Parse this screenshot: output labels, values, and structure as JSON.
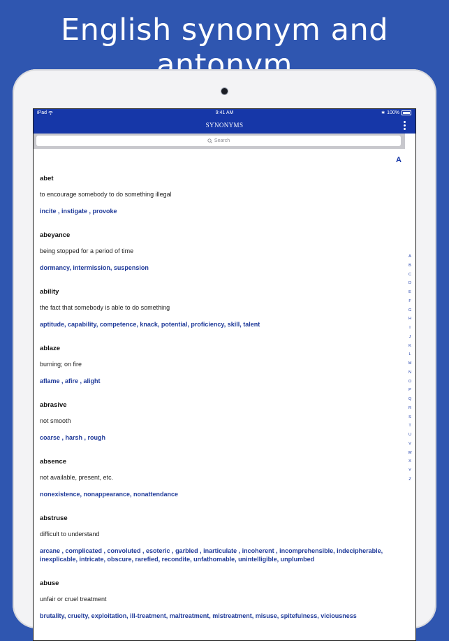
{
  "headline": "English synonym and antonym",
  "status": {
    "device": "iPad",
    "time": "9:41 AM",
    "battery": "100%"
  },
  "nav": {
    "title": "SYNONYMS"
  },
  "search": {
    "placeholder": "Search"
  },
  "section_letter": "A",
  "index_letters": [
    "A",
    "B",
    "C",
    "D",
    "E",
    "F",
    "G",
    "H",
    "I",
    "J",
    "K",
    "L",
    "M",
    "N",
    "O",
    "P",
    "Q",
    "R",
    "S",
    "T",
    "U",
    "V",
    "W",
    "X",
    "Y",
    "Z"
  ],
  "entries": [
    {
      "word": "abet",
      "definition": "to encourage somebody to do something illegal",
      "synonyms": "incite , instigate , provoke"
    },
    {
      "word": "abeyance",
      "definition": "being stopped for a period of time",
      "synonyms": "dormancy, intermission, suspension"
    },
    {
      "word": "ability",
      "definition": "the fact that somebody is able to do something",
      "synonyms": "aptitude, capability, competence, knack, potential, proficiency, skill, talent"
    },
    {
      "word": "ablaze",
      "definition": "burning; on fire",
      "synonyms": "aflame , afire , alight"
    },
    {
      "word": "abrasive",
      "definition": "not smooth",
      "synonyms": "coarse , harsh , rough"
    },
    {
      "word": "absence",
      "definition": "not available, present, etc.",
      "synonyms": "nonexistence, nonappearance, nonattendance"
    },
    {
      "word": "abstruse",
      "definition": "difficult to understand",
      "synonyms": "arcane , complicated , convoluted , esoteric , garbled , inarticulate , incoherent , incomprehensible, indecipherable, inexplicable, intricate, obscure, rarefied, recondite, unfathomable, unintelligible, unplumbed"
    },
    {
      "word": "abuse",
      "definition": "unfair or cruel treatment",
      "synonyms": "brutality, cruelty, exploitation, ill-treatment, maltreatment, mistreatment, misuse, spitefulness, viciousness"
    }
  ]
}
